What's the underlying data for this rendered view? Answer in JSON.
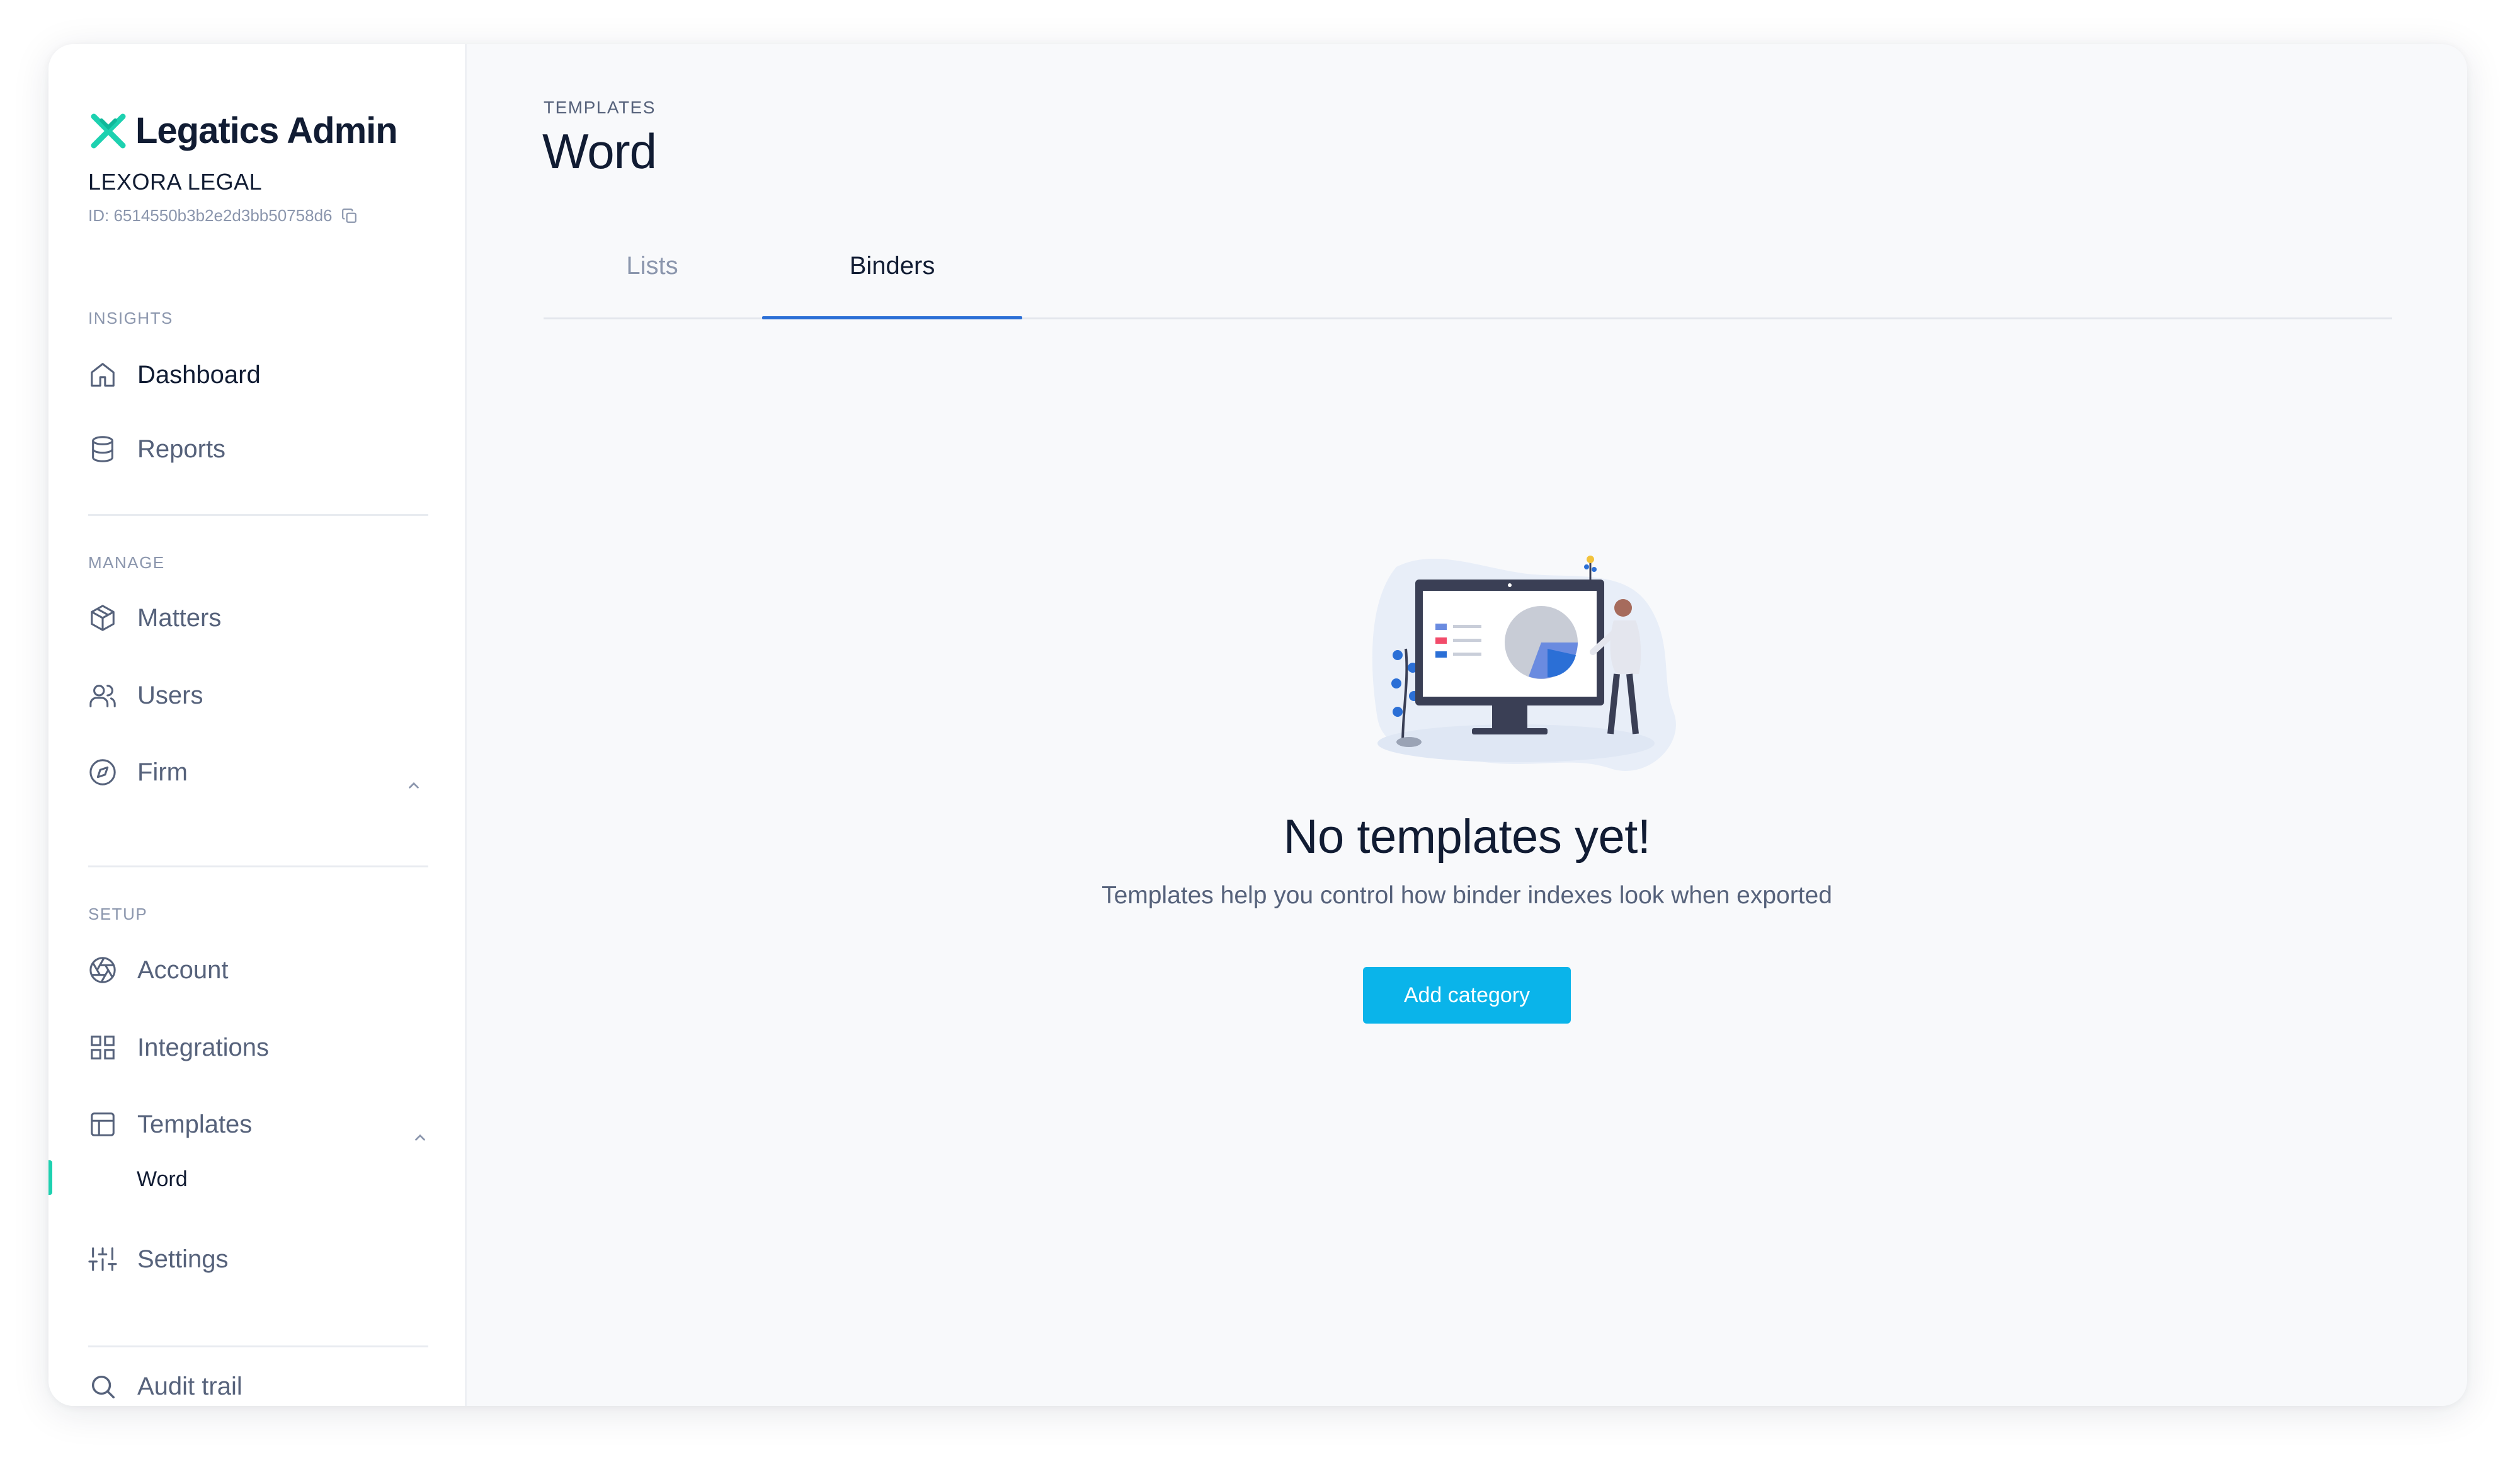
{
  "app": {
    "title": "Legatics Admin",
    "org_name": "LEXORA LEGAL",
    "org_id": "ID: 6514550b3b2e2d3bb50758d6"
  },
  "sidebar": {
    "sections": {
      "insights": "INSIGHTS",
      "manage": "MANAGE",
      "setup": "SETUP"
    },
    "items": {
      "dashboard": {
        "label": "Dashboard",
        "icon": "home-icon"
      },
      "reports": {
        "label": "Reports",
        "icon": "database-icon"
      },
      "matters": {
        "label": "Matters",
        "icon": "box-icon"
      },
      "users": {
        "label": "Users",
        "icon": "users-icon"
      },
      "firm": {
        "label": "Firm",
        "icon": "compass-icon"
      },
      "account": {
        "label": "Account",
        "icon": "aperture-icon"
      },
      "integrations": {
        "label": "Integrations",
        "icon": "grid-icon"
      },
      "templates": {
        "label": "Templates",
        "icon": "layout-icon"
      },
      "templates_word": {
        "label": "Word"
      },
      "settings": {
        "label": "Settings",
        "icon": "sliders-icon"
      },
      "audit_trail": {
        "label": "Audit trail",
        "icon": "search-icon"
      }
    }
  },
  "main": {
    "breadcrumb": "TEMPLATES",
    "title": "Word",
    "tabs": [
      {
        "label": "Lists",
        "active": false
      },
      {
        "label": "Binders",
        "active": true
      }
    ],
    "empty_state": {
      "title": "No templates yet!",
      "subtitle": "Templates help you control how binder indexes look when exported",
      "button_label": "Add category"
    }
  },
  "colors": {
    "brand_teal": "#1dd1b0",
    "primary_button": "#0ab4ea",
    "active_tab_underline": "#2b6fd6",
    "text_dark": "#111c33",
    "text_muted": "#56627b"
  }
}
